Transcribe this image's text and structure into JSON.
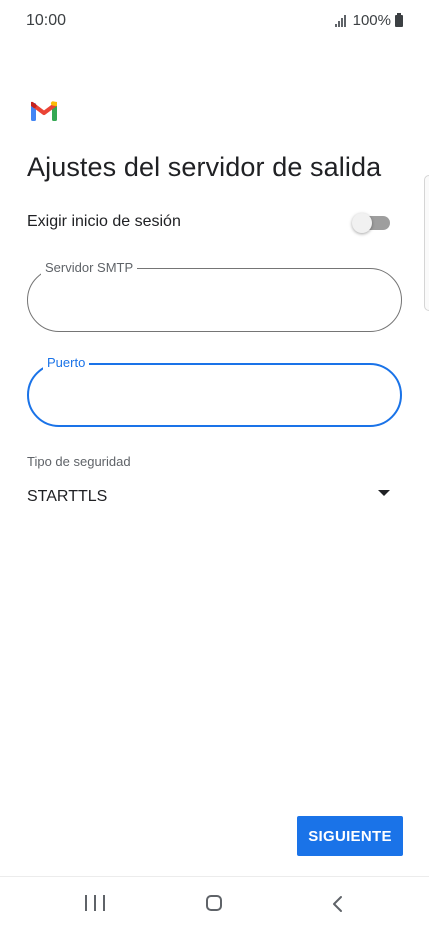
{
  "status_bar": {
    "time": "10:00",
    "battery": "100%"
  },
  "brand": {
    "logo_icon": "gmail-logo-icon",
    "colors": {
      "blue": "#4285F4",
      "red": "#EA4335",
      "yellow": "#FBBC04",
      "green": "#34A853"
    }
  },
  "page": {
    "title": "Ajustes del servidor de salida"
  },
  "signin": {
    "label": "Exigir inicio de sesión",
    "enabled": false
  },
  "smtp_field": {
    "label": "Servidor SMTP",
    "value": ""
  },
  "port_field": {
    "label": "Puerto",
    "value": "",
    "focused": true
  },
  "security": {
    "label": "Tipo de seguridad",
    "selected": "STARTTLS"
  },
  "actions": {
    "next_label": "SIGUIENTE"
  },
  "nav": {
    "recents_icon": "recents-icon",
    "home_icon": "home-icon",
    "back_icon": "back-icon"
  },
  "accent_color": "#1A73E8"
}
